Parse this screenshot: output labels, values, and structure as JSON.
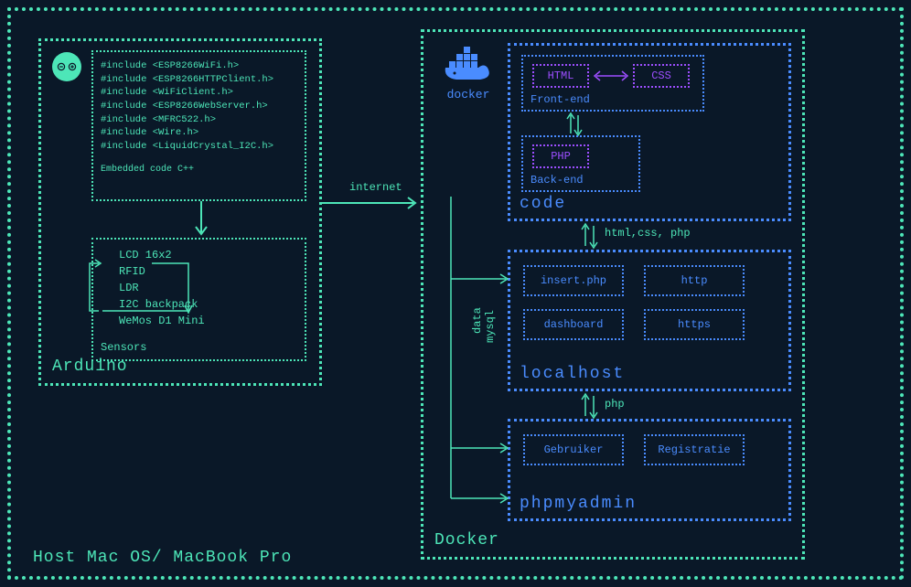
{
  "host_label": "Host Mac OS/ MacBook Pro",
  "arduino": {
    "label": "Arduino",
    "includes": [
      "#include <ESP8266WiFi.h>",
      "#include <ESP8266HTTPClient.h>",
      "#include <WiFiClient.h>",
      "#include <ESP8266WebServer.h>",
      "#include <MFRC522.h>",
      "#include <Wire.h>",
      "#include <LiquidCrystal_I2C.h>"
    ],
    "embedded_label": "Embedded code C++",
    "sensors": {
      "label": "Sensors",
      "items": [
        "LCD 16x2",
        "RFID",
        "LDR",
        "I2C backpack",
        "WeMos D1 Mini"
      ]
    }
  },
  "internet_label": "internet",
  "docker": {
    "label": "Docker",
    "logo_text": "docker",
    "code": {
      "label": "code",
      "frontend": {
        "label": "Front-end",
        "html": "HTML",
        "css": "CSS"
      },
      "backend": {
        "label": "Back-end",
        "php": "PHP"
      }
    },
    "arrow_htmlcssphp": "html,css, php",
    "localhost": {
      "label": "localhost",
      "cells": {
        "insert": "insert.php",
        "http": "http",
        "dashboard": "dashboard",
        "https": "https"
      }
    },
    "arrow_php": "php",
    "phpmyadmin": {
      "label": "phpmyadmin",
      "cells": {
        "gebruiker": "Gebruiker",
        "registratie": "Registratie"
      }
    },
    "side_labels": {
      "data": "data",
      "mysql": "mysql"
    }
  }
}
